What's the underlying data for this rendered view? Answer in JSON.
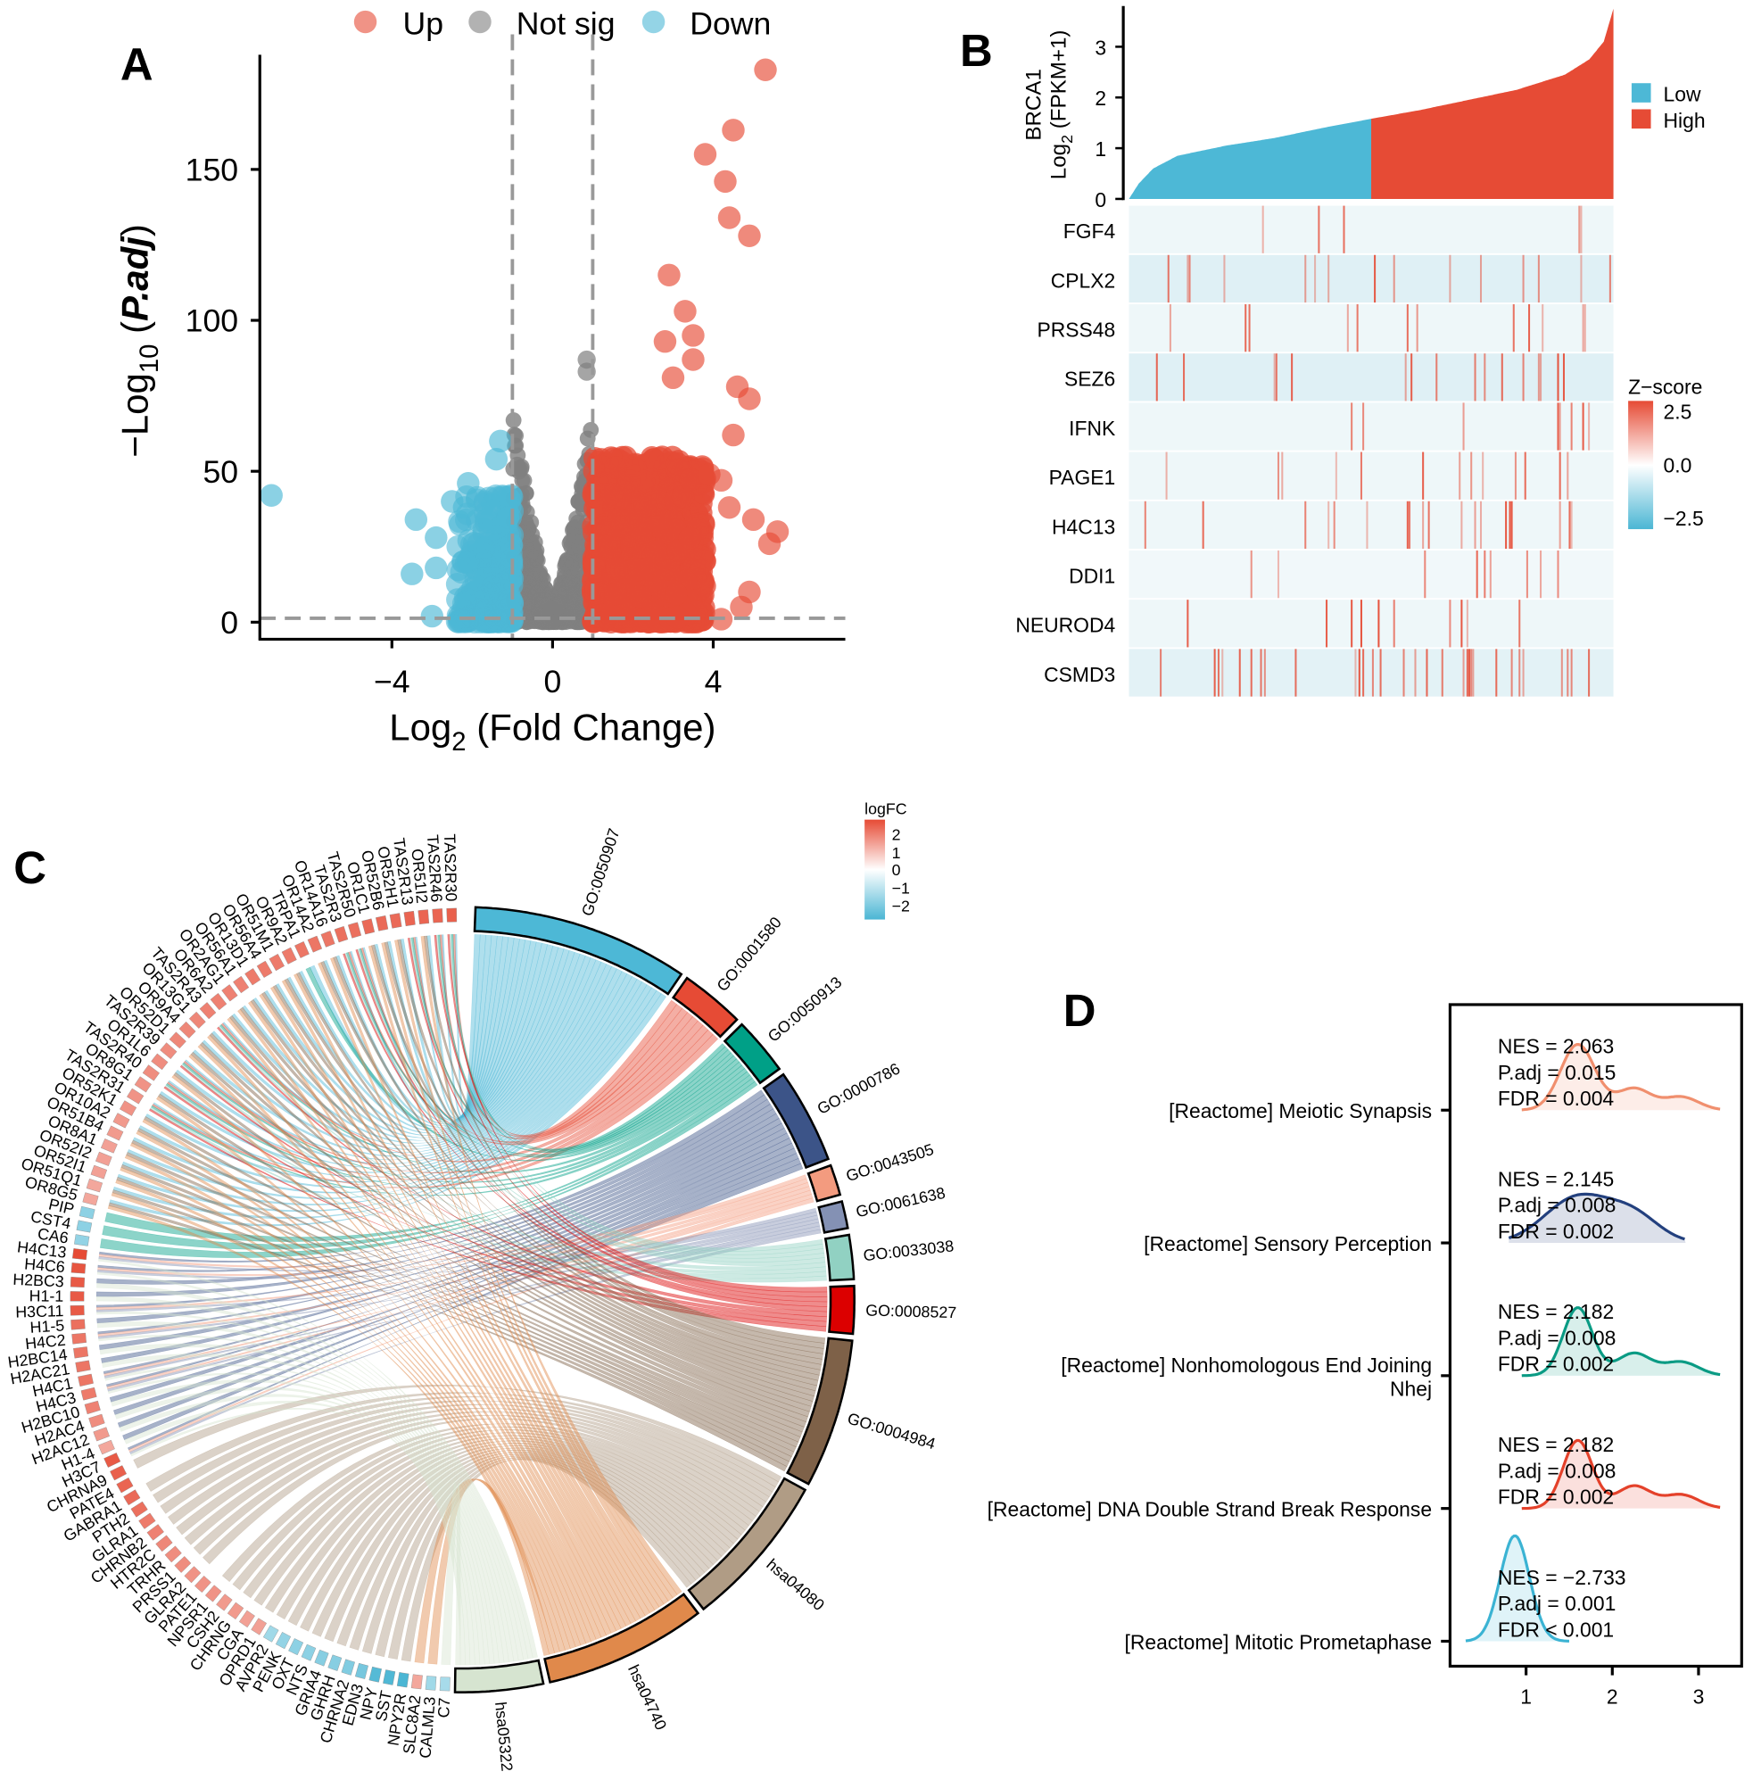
{
  "panels": {
    "a": "A",
    "b": "B",
    "c": "C",
    "d": "D"
  },
  "chart_data": [
    {
      "type": "scatter",
      "legend": [
        {
          "label": "Up",
          "color": "#e64b35"
        },
        {
          "label": "Not sig",
          "color": "#7f7f7f"
        },
        {
          "label": "Down",
          "color": "#4db8d6"
        }
      ],
      "legend_placement": "top",
      "xlabel_parts": [
        "Log",
        "2",
        " (Fold Change)"
      ],
      "ylabel_parts": [
        "−Log",
        "10",
        " (",
        "P.adj",
        ")"
      ],
      "xticks": [
        -4,
        0,
        4
      ],
      "xtick_labels": [
        "−4",
        "0",
        "4"
      ],
      "yticks": [
        0,
        50,
        100,
        150
      ],
      "ytick_labels": [
        "0",
        "50",
        "100",
        "150"
      ],
      "xlim": [
        -7.3,
        7.3
      ],
      "ylim": [
        -5.6,
        187
      ],
      "thresholds": {
        "log2fc": [
          -1,
          1
        ],
        "neglog10_padj": 1.3
      },
      "highlighted_points": {
        "up": [
          [
            5.3,
            183
          ],
          [
            4.5,
            163
          ],
          [
            3.8,
            155
          ],
          [
            4.3,
            146
          ],
          [
            4.4,
            134
          ],
          [
            4.9,
            128
          ],
          [
            2.9,
            115
          ],
          [
            3.3,
            103
          ],
          [
            2.8,
            93
          ],
          [
            3.5,
            95
          ],
          [
            3.5,
            87
          ],
          [
            3.0,
            81
          ],
          [
            4.6,
            78
          ],
          [
            4.9,
            74
          ],
          [
            4.5,
            62
          ],
          [
            4.2,
            47
          ],
          [
            4.4,
            38
          ],
          [
            5.0,
            34
          ],
          [
            5.6,
            30
          ],
          [
            5.4,
            26
          ],
          [
            4.9,
            10
          ],
          [
            4.7,
            5
          ],
          [
            4.2,
            1
          ],
          [
            3.9,
            49
          ]
        ],
        "down": [
          [
            -7.0,
            42
          ],
          [
            -3.4,
            34
          ],
          [
            -2.9,
            28
          ],
          [
            -3.5,
            16
          ],
          [
            -2.5,
            40
          ],
          [
            -2.2,
            38
          ],
          [
            -1.3,
            60
          ],
          [
            -1.4,
            54
          ],
          [
            -2.1,
            46
          ],
          [
            -3.0,
            2
          ],
          [
            -2.9,
            18
          ]
        ],
        "not_sig": [
          [
            0.85,
            87
          ],
          [
            0.85,
            83
          ]
        ]
      }
    },
    {
      "type": "area",
      "ylabel_parts": [
        "BRCA1",
        "Log",
        "2",
        " (FPKM+1)"
      ],
      "yticks": [
        0,
        1,
        2,
        3
      ],
      "ytick_labels": [
        "0",
        "1",
        "2",
        "3"
      ],
      "ylim": [
        0,
        3.8
      ],
      "sorted_expression_profile": {
        "percentile": [
          0,
          2,
          5,
          10,
          20,
          30,
          40,
          50,
          60,
          70,
          80,
          90,
          95,
          98,
          100
        ],
        "value": [
          0,
          0.3,
          0.6,
          0.85,
          1.05,
          1.2,
          1.4,
          1.58,
          1.75,
          1.95,
          2.15,
          2.45,
          2.75,
          3.1,
          3.75
        ]
      },
      "split_percentile": 50,
      "groups": [
        {
          "label": "Low",
          "color": "#4db8d6"
        },
        {
          "label": "High",
          "color": "#e64b35"
        }
      ],
      "heatmap": {
        "type": "heatmap",
        "rows": [
          "FGF4",
          "CPLX2",
          "PRSS48",
          "SEZ6",
          "IFNK",
          "PAGE1",
          "H4C13",
          "DDI1",
          "NEUROD4",
          "CSMD3"
        ],
        "legend_title": "Z−score",
        "legend_ticks": [
          "2.5",
          "0.0",
          "−2.5"
        ],
        "color_range": [
          -2.5,
          2.5
        ],
        "colors": {
          "low": "#4bb6d4",
          "mid": "#ffffff",
          "high": "#e64b35"
        }
      }
    },
    {
      "type": "chord",
      "legend_title": "logFC",
      "legend_ticks": [
        "2",
        "1",
        "0",
        "−1",
        "−2"
      ],
      "color_range": [
        -2.5,
        2.5
      ],
      "genes": [
        {
          "name": "TAS2R30",
          "logFC": 2.1
        },
        {
          "name": "TAS2R46",
          "logFC": 2.0
        },
        {
          "name": "OR51I2",
          "logFC": 2.0
        },
        {
          "name": "TAS2R13",
          "logFC": 2.0
        },
        {
          "name": "OR52H1",
          "logFC": 1.9
        },
        {
          "name": "OR52B6",
          "logFC": 1.9
        },
        {
          "name": "OR1C1",
          "logFC": 1.9
        },
        {
          "name": "TAS2R50",
          "logFC": 1.8
        },
        {
          "name": "TAS2R3",
          "logFC": 1.8
        },
        {
          "name": "OR14A16",
          "logFC": 1.7
        },
        {
          "name": "OR14A2",
          "logFC": 1.7
        },
        {
          "name": "TRPA1",
          "logFC": 1.7
        },
        {
          "name": "OR9A2",
          "logFC": 1.6
        },
        {
          "name": "OR51M1",
          "logFC": 1.6
        },
        {
          "name": "OR56A4",
          "logFC": 1.6
        },
        {
          "name": "OR13D1",
          "logFC": 1.6
        },
        {
          "name": "OR56A1",
          "logFC": 1.5
        },
        {
          "name": "OR2AG1",
          "logFC": 1.5
        },
        {
          "name": "OR6A2",
          "logFC": 1.5
        },
        {
          "name": "TAS2R43",
          "logFC": 1.5
        },
        {
          "name": "OR13G1",
          "logFC": 1.4
        },
        {
          "name": "OR9A4",
          "logFC": 1.4
        },
        {
          "name": "OR52D1",
          "logFC": 1.4
        },
        {
          "name": "TAS2R39",
          "logFC": 1.3
        },
        {
          "name": "OR1L6",
          "logFC": 1.3
        },
        {
          "name": "TAS2R40",
          "logFC": 1.3
        },
        {
          "name": "OR8G1",
          "logFC": 1.2
        },
        {
          "name": "TAS2R31",
          "logFC": 1.2
        },
        {
          "name": "OR52K1",
          "logFC": 1.2
        },
        {
          "name": "OR10A2",
          "logFC": 1.1
        },
        {
          "name": "OR51B4",
          "logFC": 1.1
        },
        {
          "name": "OR8A1",
          "logFC": 1.0
        },
        {
          "name": "OR52I2",
          "logFC": 1.0
        },
        {
          "name": "OR52I1",
          "logFC": 1.0
        },
        {
          "name": "OR51Q1",
          "logFC": 0.9
        },
        {
          "name": "OR8G5",
          "logFC": 0.9
        },
        {
          "name": "PIP",
          "logFC": -1.3
        },
        {
          "name": "CST4",
          "logFC": -1.3
        },
        {
          "name": "CA6",
          "logFC": -1.2
        },
        {
          "name": "H4C13",
          "logFC": 2.5
        },
        {
          "name": "H4C6",
          "logFC": 2.3
        },
        {
          "name": "H2BC3",
          "logFC": 2.2
        },
        {
          "name": "H1-1",
          "logFC": 2.2
        },
        {
          "name": "H3C11",
          "logFC": 2.2
        },
        {
          "name": "H1-5",
          "logFC": 1.8
        },
        {
          "name": "H4C2",
          "logFC": 1.7
        },
        {
          "name": "H2BC14",
          "logFC": 1.7
        },
        {
          "name": "H2AC21",
          "logFC": 1.7
        },
        {
          "name": "H4C1",
          "logFC": 1.7
        },
        {
          "name": "H4C3",
          "logFC": 1.6
        },
        {
          "name": "H2BC10",
          "logFC": 1.5
        },
        {
          "name": "H2AC4",
          "logFC": 1.3
        },
        {
          "name": "H2AC12",
          "logFC": 1.1
        },
        {
          "name": "H1-4",
          "logFC": 0.9
        },
        {
          "name": "H3C7",
          "logFC": 2.2
        },
        {
          "name": "CHRNA9",
          "logFC": 2.1
        },
        {
          "name": "PATE4",
          "logFC": 2.0
        },
        {
          "name": "GABRA1",
          "logFC": 1.9
        },
        {
          "name": "PTH2",
          "logFC": 1.8
        },
        {
          "name": "GLRA1",
          "logFC": 1.6
        },
        {
          "name": "CHRNB2",
          "logFC": 1.5
        },
        {
          "name": "HTR2C",
          "logFC": 1.4
        },
        {
          "name": "TRHR",
          "logFC": 1.3
        },
        {
          "name": "PRSS1",
          "logFC": 1.3
        },
        {
          "name": "GLRA2",
          "logFC": 1.2
        },
        {
          "name": "PATE1",
          "logFC": 1.2
        },
        {
          "name": "NPSR1",
          "logFC": 1.2
        },
        {
          "name": "CSH2",
          "logFC": 1.1
        },
        {
          "name": "CHRNG",
          "logFC": 1.1
        },
        {
          "name": "CGA",
          "logFC": 1.0
        },
        {
          "name": "OPRD1",
          "logFC": 1.0
        },
        {
          "name": "AVPR2",
          "logFC": -1.0
        },
        {
          "name": "PENK",
          "logFC": -1.2
        },
        {
          "name": "OXT",
          "logFC": -1.3
        },
        {
          "name": "NTS",
          "logFC": -1.3
        },
        {
          "name": "GRIA4",
          "logFC": -1.4
        },
        {
          "name": "GHRH",
          "logFC": -1.4
        },
        {
          "name": "CHRNA2",
          "logFC": -1.5
        },
        {
          "name": "EDN3",
          "logFC": -1.7
        },
        {
          "name": "NPY",
          "logFC": -2.3
        },
        {
          "name": "SST",
          "logFC": -2.4
        },
        {
          "name": "NPY2R",
          "logFC": -2.5
        },
        {
          "name": "SLC8A2",
          "logFC": 0.9
        },
        {
          "name": "CALML3",
          "logFC": -1.0
        },
        {
          "name": "C7",
          "logFC": -0.9
        }
      ],
      "terms": [
        {
          "id": "GO:0050907",
          "color": "#4db8d6",
          "genes": [
            "TAS2R30",
            "TAS2R46",
            "OR51I2",
            "TAS2R13",
            "OR52H1",
            "OR52B6",
            "OR1C1",
            "TAS2R50",
            "TAS2R3",
            "OR14A16",
            "OR14A2",
            "TRPA1",
            "OR9A2",
            "OR51M1",
            "OR56A4",
            "OR13D1",
            "OR56A1",
            "OR2AG1",
            "OR6A2",
            "TAS2R43",
            "OR13G1",
            "OR9A4",
            "OR52D1",
            "TAS2R39",
            "OR1L6",
            "TAS2R40",
            "OR8G1",
            "TAS2R31",
            "OR52K1",
            "OR10A2",
            "OR51B4",
            "OR8A1",
            "OR52I2",
            "OR52I1",
            "OR51Q1",
            "OR8G5"
          ]
        },
        {
          "id": "GO:0001580",
          "color": "#e64b35",
          "genes": [
            "TAS2R30",
            "TAS2R46",
            "TAS2R13",
            "TAS2R50",
            "TAS2R3",
            "TAS2R43",
            "TAS2R39",
            "TAS2R40",
            "TAS2R31"
          ]
        },
        {
          "id": "GO:0050913",
          "color": "#00a087",
          "genes": [
            "TAS2R30",
            "TAS2R46",
            "TAS2R13",
            "TAS2R50",
            "TAS2R3",
            "TRPA1",
            "TAS2R43",
            "TAS2R39",
            "TAS2R40",
            "TAS2R31",
            "PIP",
            "CST4",
            "CA6"
          ]
        },
        {
          "id": "GO:0000786",
          "color": "#3c5488",
          "genes": [
            "H4C13",
            "H4C6",
            "H2BC3",
            "H1-1",
            "H3C11",
            "H1-5",
            "H4C2",
            "H2BC14",
            "H2AC21",
            "H4C1",
            "H4C3",
            "H2BC10",
            "H2AC4",
            "H2AC12",
            "H1-4",
            "H3C7"
          ]
        },
        {
          "id": "GO:0043505",
          "color": "#f39b7f",
          "genes": [
            "H4C13",
            "H4C6",
            "H3C11",
            "H4C2",
            "H4C1",
            "H4C3",
            "H3C7"
          ]
        },
        {
          "id": "GO:0061638",
          "color": "#8491b4",
          "genes": [
            "H4C13",
            "H4C6",
            "H3C11",
            "H4C2",
            "H4C1",
            "H4C3",
            "H3C7"
          ]
        },
        {
          "id": "GO:0033038",
          "color": "#91d1c2",
          "genes": [
            "TAS2R30",
            "TAS2R46",
            "TAS2R13",
            "TAS2R50",
            "TAS2R3",
            "TAS2R43",
            "TAS2R39",
            "TAS2R40",
            "TAS2R31"
          ]
        },
        {
          "id": "GO:0008527",
          "color": "#dc0000",
          "genes": [
            "TAS2R30",
            "TAS2R46",
            "TAS2R13",
            "TAS2R50",
            "TAS2R3",
            "TAS2R43",
            "TAS2R39",
            "TAS2R40",
            "TAS2R31"
          ]
        },
        {
          "id": "GO:0004984",
          "color": "#7e6148",
          "genes": [
            "OR51I2",
            "OR52H1",
            "OR52B6",
            "OR1C1",
            "OR14A16",
            "OR14A2",
            "OR9A2",
            "OR51M1",
            "OR56A4",
            "OR13D1",
            "OR56A1",
            "OR2AG1",
            "OR6A2",
            "OR13G1",
            "OR9A4",
            "OR52D1",
            "OR1L6",
            "OR8G1",
            "OR52K1",
            "OR10A2",
            "OR51B4",
            "OR8A1",
            "OR52I2",
            "OR52I1",
            "OR51Q1",
            "OR8G5"
          ]
        },
        {
          "id": "hsa04080",
          "color": "#b09c85",
          "genes": [
            "CHRNA9",
            "GABRA1",
            "PTH2",
            "GLRA1",
            "CHRNB2",
            "HTR2C",
            "TRHR",
            "PRSS1",
            "GLRA2",
            "NPSR1",
            "CSH2",
            "CHRNG",
            "CGA",
            "OPRD1",
            "AVPR2",
            "PENK",
            "OXT",
            "NTS",
            "GRIA4",
            "GHRH",
            "CHRNA2",
            "EDN3",
            "NPY",
            "SST",
            "NPY2R"
          ]
        },
        {
          "id": "hsa04740",
          "color": "#e0894b",
          "genes": [
            "OR51I2",
            "OR52H1",
            "OR52B6",
            "OR1C1",
            "OR14A16",
            "OR14A2",
            "OR9A2",
            "OR51M1",
            "OR56A4",
            "OR13D1",
            "OR56A1",
            "OR2AG1",
            "OR6A2",
            "OR13G1",
            "OR9A4",
            "OR52D1",
            "OR1L6",
            "OR8G1",
            "OR52K1",
            "OR10A2",
            "OR51B4",
            "OR8A1",
            "OR52I2",
            "OR52I1",
            "OR51Q1",
            "OR8G5",
            "SLC8A2",
            "CALML3"
          ]
        },
        {
          "id": "hsa05322",
          "color": "#d6e4d0",
          "genes": [
            "H4C13",
            "H4C6",
            "H2BC3",
            "H1-1",
            "H3C11",
            "H1-5",
            "H4C2",
            "H2BC14",
            "H2AC21",
            "H4C1",
            "H4C3",
            "H2BC10",
            "H2AC4",
            "H2AC12",
            "H1-4",
            "H3C7",
            "C7"
          ]
        }
      ]
    },
    {
      "type": "ridge",
      "xticks": [
        1,
        2,
        3
      ],
      "xtick_labels": [
        "1",
        "2",
        "3"
      ],
      "rows": [
        {
          "label": [
            "[Reactome] Meiotic Synapsis"
          ],
          "color": "#f08f6e",
          "nes": "NES = 2.063",
          "padj": "P.adj = 0.015",
          "fdr": "FDR = 0.004"
        },
        {
          "label": [
            "[Reactome] Sensory Perception"
          ],
          "color": "#23407e",
          "nes": "NES = 2.145",
          "padj": "P.adj = 0.008",
          "fdr": "FDR = 0.002"
        },
        {
          "label": [
            "[Reactome] Nonhomologous End Joining",
            "Nhej"
          ],
          "color": "#0a9b84",
          "nes": "NES = 2.182",
          "padj": "P.adj = 0.008",
          "fdr": "FDR = 0.002"
        },
        {
          "label": [
            "[Reactome] DNA Double Strand Break Response"
          ],
          "color": "#e4412a",
          "nes": "NES = 2.182",
          "padj": "P.adj = 0.008",
          "fdr": "FDR = 0.002"
        },
        {
          "label": [
            "[Reactome] Mitotic Prometaphase"
          ],
          "color": "#3bb3d3",
          "nes": "NES = −2.733",
          "padj": "P.adj = 0.001",
          "fdr": "FDR < 0.001"
        }
      ]
    }
  ]
}
